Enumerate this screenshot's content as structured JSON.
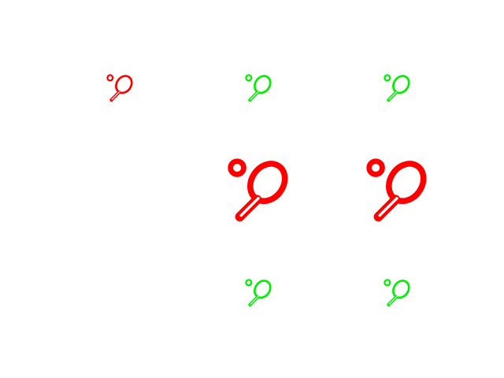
{
  "icon_name": "tennis-racket-ball-icon",
  "colors": {
    "red": "#ff0000",
    "green": "#00ee00"
  },
  "grid": [
    {
      "id": "i-r0c0",
      "color": "red",
      "size": "small"
    },
    {
      "id": "i-r0c1",
      "color": "green",
      "size": "small"
    },
    {
      "id": "i-r0c2",
      "color": "green",
      "size": "small"
    },
    {
      "id": "i-r1c1",
      "color": "red",
      "size": "large"
    },
    {
      "id": "i-r1c2",
      "color": "red",
      "size": "large"
    },
    {
      "id": "i-r2c1",
      "color": "green",
      "size": "small"
    },
    {
      "id": "i-r2c2",
      "color": "green",
      "size": "small"
    }
  ]
}
